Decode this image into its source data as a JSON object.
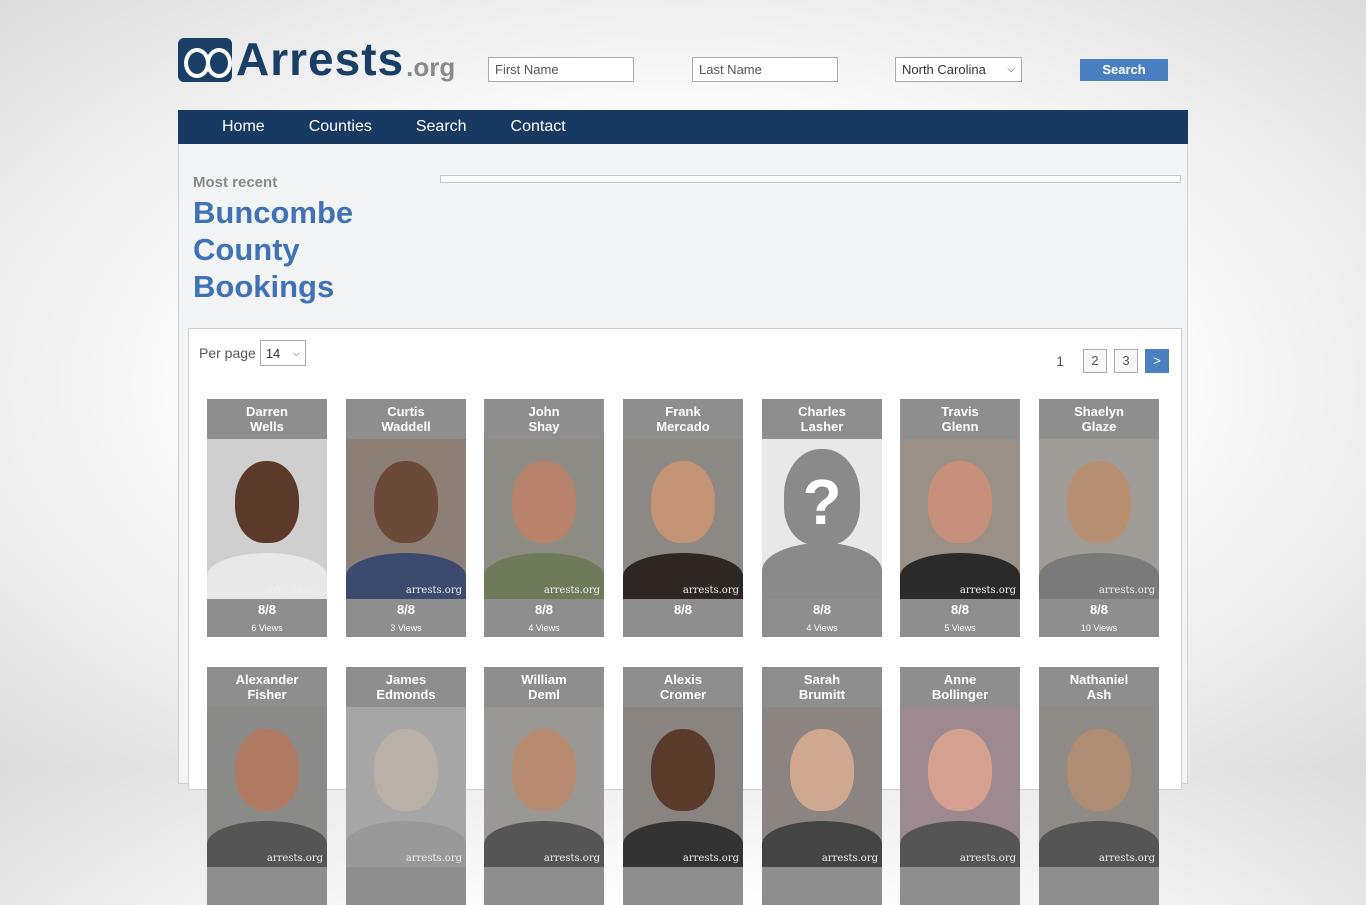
{
  "brand": {
    "name": "Arrests",
    "tld": ".org"
  },
  "search": {
    "first_name_placeholder": "First Name",
    "last_name_placeholder": "Last Name",
    "state_selected": "North Carolina",
    "button_label": "Search"
  },
  "nav": {
    "items": [
      "Home",
      "Counties",
      "Search",
      "Contact"
    ]
  },
  "intro": {
    "kicker": "Most recent",
    "title": "Buncombe County Bookings"
  },
  "listing": {
    "per_page_label": "Per page",
    "per_page_value": "14",
    "pagination": {
      "current": "1",
      "pages": [
        "2",
        "3"
      ],
      "next": ">"
    },
    "watermark": "arrests.org",
    "people": [
      {
        "first": "Darren",
        "last": "Wells",
        "date": "8/8",
        "views": "6 Views",
        "skin": "#5b3a2a",
        "shirt": "#e8e8e8",
        "bg": "#cfcfcf",
        "unknown": false
      },
      {
        "first": "Curtis",
        "last": "Waddell",
        "date": "8/8",
        "views": "3 Views",
        "skin": "#6b4a3a",
        "shirt": "#3b4a6e",
        "bg": "#8b7f76",
        "unknown": false
      },
      {
        "first": "John",
        "last": "Shay",
        "date": "8/8",
        "views": "4 Views",
        "skin": "#b8826a",
        "shirt": "#6e7a5a",
        "bg": "#8c8c84",
        "unknown": false
      },
      {
        "first": "Frank",
        "last": "Mercado",
        "date": "8/8",
        "views": "",
        "skin": "#c49474",
        "shirt": "#2e2622",
        "bg": "#8c8884",
        "unknown": false
      },
      {
        "first": "Charles",
        "last": "Lasher",
        "date": "8/8",
        "views": "4 Views",
        "skin": "",
        "shirt": "",
        "bg": "",
        "unknown": true
      },
      {
        "first": "Travis",
        "last": "Glenn",
        "date": "8/8",
        "views": "5 Views",
        "skin": "#c8907a",
        "shirt": "#2a2a2a",
        "bg": "#9a9088",
        "unknown": false
      },
      {
        "first": "Shaelyn",
        "last": "Glaze",
        "date": "8/8",
        "views": "10 Views",
        "skin": "#b98f72",
        "shirt": "#7a7a7a",
        "bg": "#a09c98",
        "unknown": false
      },
      {
        "first": "Alexander",
        "last": "Fisher",
        "date": "",
        "views": "",
        "skin": "#b07a62",
        "shirt": "#555",
        "bg": "#8a8a88",
        "unknown": false
      },
      {
        "first": "James",
        "last": "Edmonds",
        "date": "",
        "views": "",
        "skin": "#b9b0a8",
        "shirt": "#999",
        "bg": "#a6a6a6",
        "unknown": false
      },
      {
        "first": "William",
        "last": "Deml",
        "date": "",
        "views": "",
        "skin": "#b88a70",
        "shirt": "#555",
        "bg": "#9a9894",
        "unknown": false
      },
      {
        "first": "Alexis",
        "last": "Cromer",
        "date": "",
        "views": "",
        "skin": "#5a3a2a",
        "shirt": "#333",
        "bg": "#8a8480",
        "unknown": false
      },
      {
        "first": "Sarah",
        "last": "Brumitt",
        "date": "",
        "views": "",
        "skin": "#d0a890",
        "shirt": "#444",
        "bg": "#8c8480",
        "unknown": false
      },
      {
        "first": "Anne",
        "last": "Bollinger",
        "date": "",
        "views": "",
        "skin": "#d6a090",
        "shirt": "#555",
        "bg": "#9c8a90",
        "unknown": false
      },
      {
        "first": "Nathaniel",
        "last": "Ash",
        "date": "",
        "views": "",
        "skin": "#b08c72",
        "shirt": "#555",
        "bg": "#8e8a86",
        "unknown": false
      }
    ]
  }
}
